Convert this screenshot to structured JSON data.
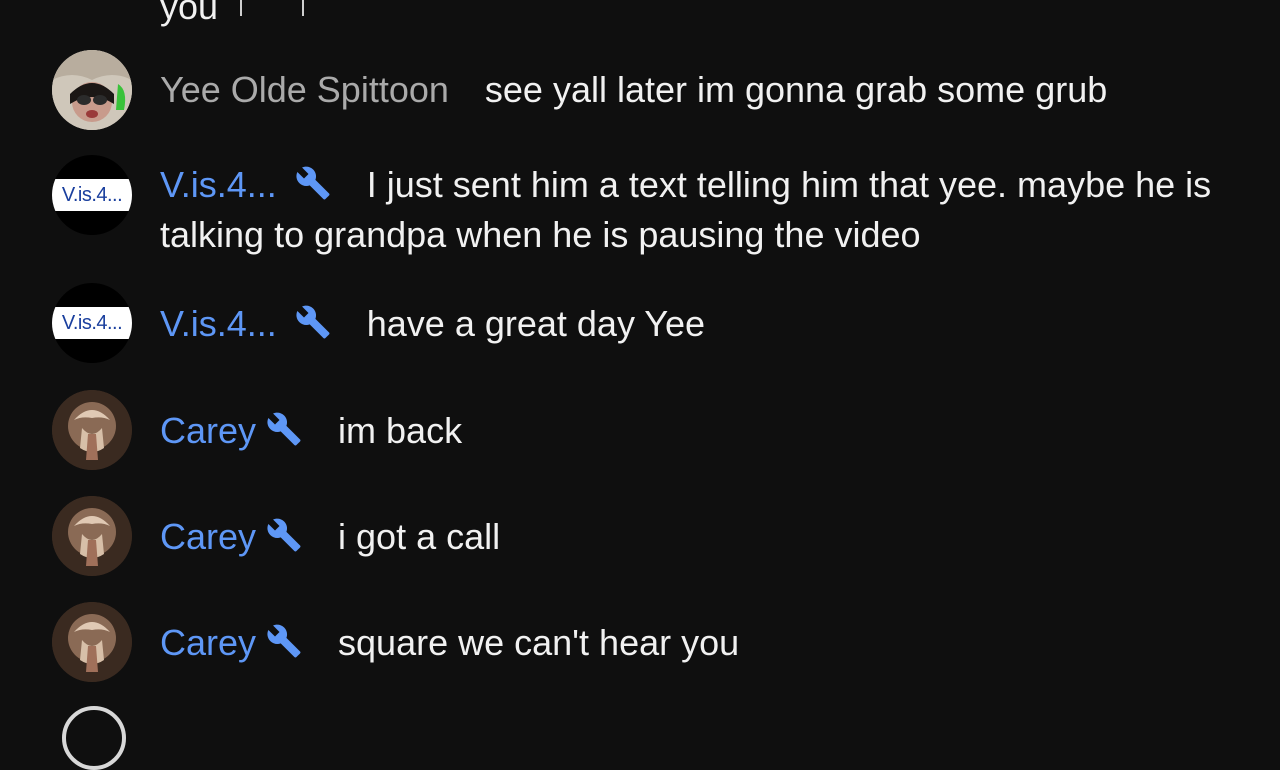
{
  "top_fragment": {
    "text": "you"
  },
  "messages": [
    {
      "author": "Yee Olde Spittoon",
      "author_color": "#aaaaaa",
      "moderator": false,
      "avatar": "photo-avatar",
      "text": "see yall later im gonna grab some grub"
    },
    {
      "author": "V.is.4...",
      "author_color": "#5e97f6",
      "moderator": true,
      "avatar": "V.is.4...",
      "text": "I just sent him a text telling him that yee. maybe he is talking to grandpa when he is pausing the video"
    },
    {
      "author": "V.is.4...",
      "author_color": "#5e97f6",
      "moderator": true,
      "avatar": "V.is.4...",
      "text": "have a great day Yee"
    },
    {
      "author": "Carey",
      "author_color": "#5e97f6",
      "moderator": true,
      "avatar": "photo-avatar",
      "text": "im back"
    },
    {
      "author": "Carey",
      "author_color": "#5e97f6",
      "moderator": true,
      "avatar": "photo-avatar",
      "text": "i got a call"
    },
    {
      "author": "Carey",
      "author_color": "#5e97f6",
      "moderator": true,
      "avatar": "photo-avatar",
      "text": "square we can't hear you"
    }
  ],
  "icons": {
    "moderator_badge": "wrench-icon"
  },
  "colors": {
    "background": "#0f0f0f",
    "message_text": "#f1f1f1",
    "moderator_name": "#5e97f6",
    "regular_name": "#aaaaaa"
  }
}
